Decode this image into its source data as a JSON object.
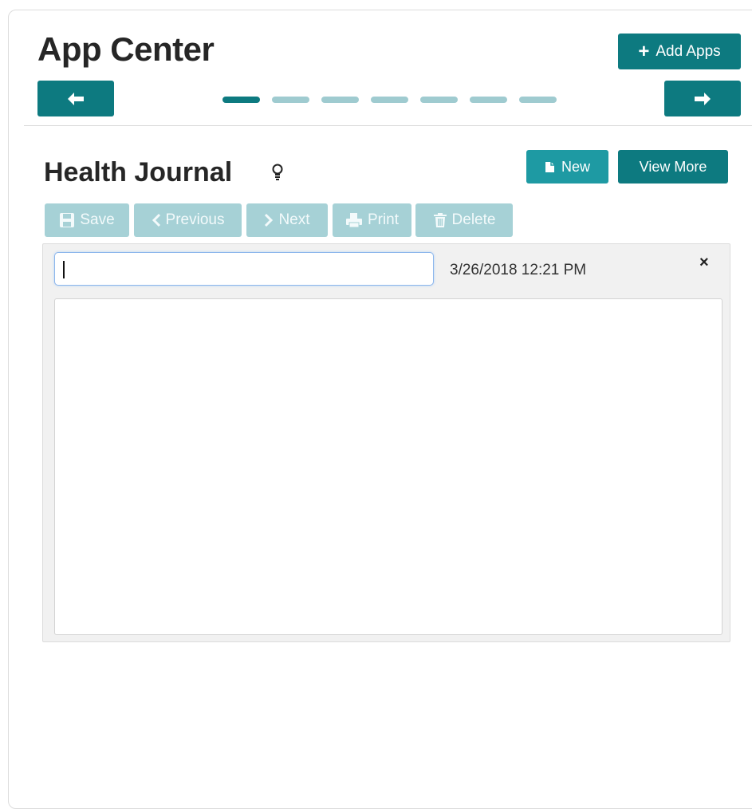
{
  "app": {
    "title": "App Center",
    "add_apps_label": "Add Apps",
    "carousel": {
      "page_count": 7,
      "active_index": 0
    }
  },
  "widget": {
    "title": "Health Journal",
    "new_label": "New",
    "view_more_label": "View More"
  },
  "toolbar": {
    "save_label": "Save",
    "previous_label": "Previous",
    "next_label": "Next",
    "print_label": "Print",
    "delete_label": "Delete"
  },
  "entry": {
    "title_value": "",
    "timestamp": "3/26/2018 12:21 PM",
    "close_label": "×",
    "body_value": ""
  },
  "colors": {
    "primary": "#0d7a80",
    "secondary": "#1e9aa3",
    "disabled": "#a6d1d6",
    "dot_inactive": "#9fcbd0"
  }
}
